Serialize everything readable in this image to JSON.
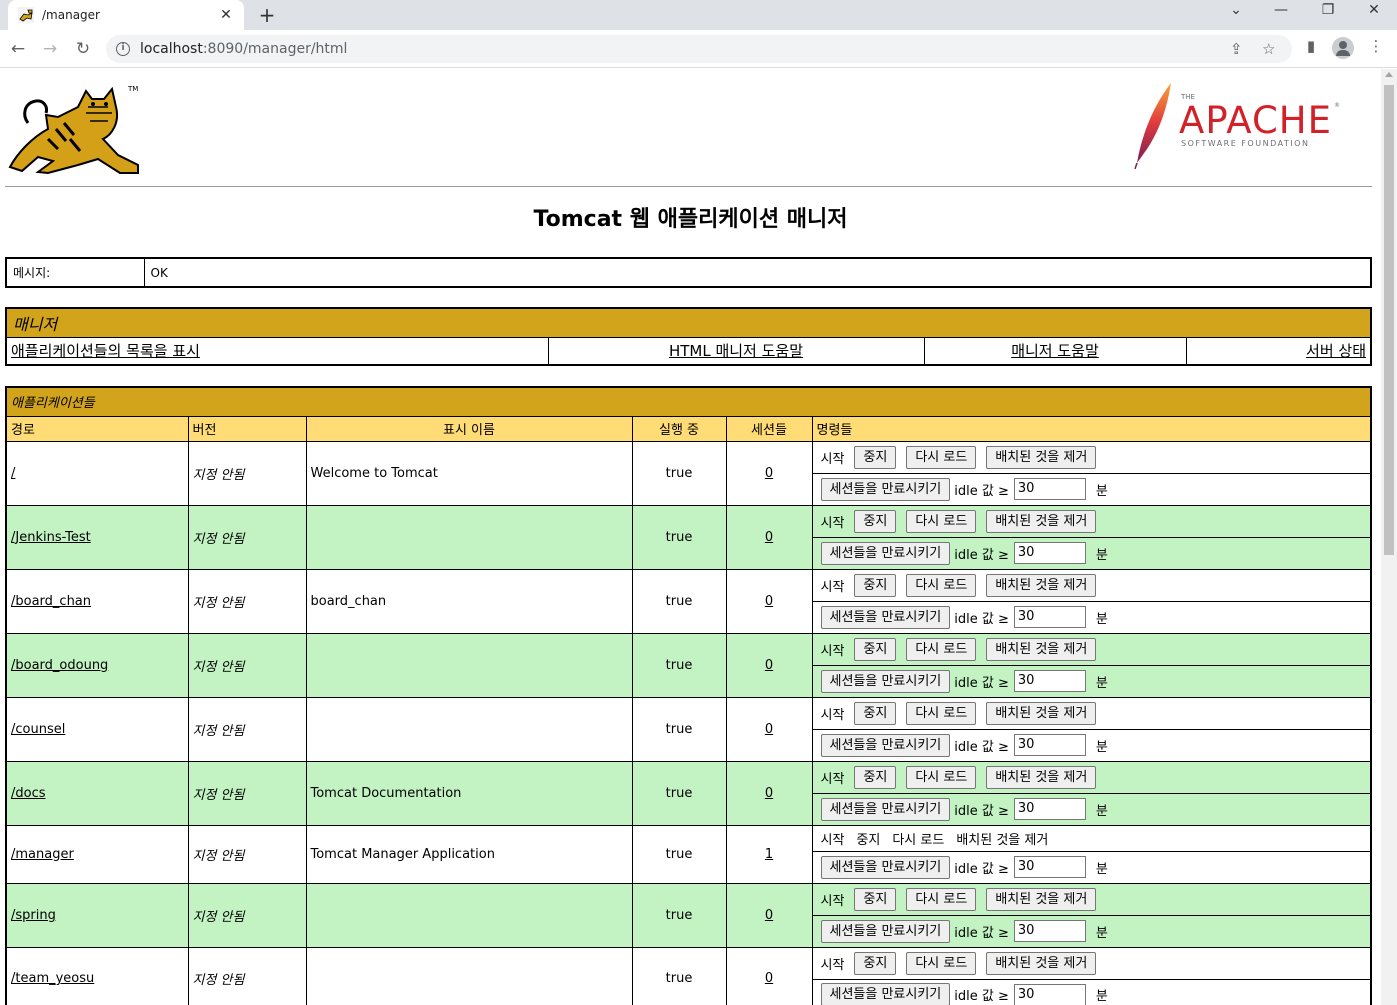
{
  "browser": {
    "tab_title": "/manager",
    "url_host": "localhost",
    "url_rest": ":8090/manager/html"
  },
  "page": {
    "title": "Tomcat 웹 애플리케이션 매니저",
    "logos": {
      "tomcat_mark": "TM",
      "apache_the": "THE",
      "apache_name": "APACHE",
      "apache_reg": "®",
      "apache_sub": "SOFTWARE FOUNDATION"
    },
    "message": {
      "label": "메시지:",
      "value": "OK"
    },
    "manager": {
      "heading": "매니저",
      "links": [
        "애플리케이션들의 목록을 표시",
        "HTML 매니저 도움말",
        "매니저 도움말",
        "서버 상태"
      ]
    },
    "applications": {
      "heading": "애플리케이션들",
      "columns": [
        "경로",
        "버전",
        "표시 이름",
        "실행 중",
        "세션들",
        "명령들"
      ],
      "commands": {
        "start": "시작",
        "stop": "중지",
        "reload": "다시 로드",
        "undeploy": "배치된 것을 제거",
        "expire": "세션들을 만료시키기",
        "idle": "idle 값 ≥",
        "idle_value": "30",
        "minutes": "분"
      },
      "rows": [
        {
          "path": "/",
          "version": "지정 안됨",
          "display": "Welcome to Tomcat",
          "running": "true",
          "sessions": "0"
        },
        {
          "path": "/Jenkins-Test",
          "version": "지정 안됨",
          "display": "",
          "running": "true",
          "sessions": "0"
        },
        {
          "path": "/board_chan",
          "version": "지정 안됨",
          "display": "board_chan",
          "running": "true",
          "sessions": "0"
        },
        {
          "path": "/board_odoung",
          "version": "지정 안됨",
          "display": "",
          "running": "true",
          "sessions": "0"
        },
        {
          "path": "/counsel",
          "version": "지정 안됨",
          "display": "",
          "running": "true",
          "sessions": "0"
        },
        {
          "path": "/docs",
          "version": "지정 안됨",
          "display": "Tomcat Documentation",
          "running": "true",
          "sessions": "0"
        },
        {
          "path": "/manager",
          "version": "지정 안됨",
          "display": "Tomcat Manager Application",
          "running": "true",
          "sessions": "1"
        },
        {
          "path": "/spring",
          "version": "지정 안됨",
          "display": "",
          "running": "true",
          "sessions": "0"
        },
        {
          "path": "/team_yeosu",
          "version": "지정 안됨",
          "display": "",
          "running": "true",
          "sessions": "0"
        }
      ]
    }
  },
  "colors": {
    "section_header": "#d2a41c",
    "column_header": "#ffdc75",
    "row_alt": "#c3f3c3"
  }
}
